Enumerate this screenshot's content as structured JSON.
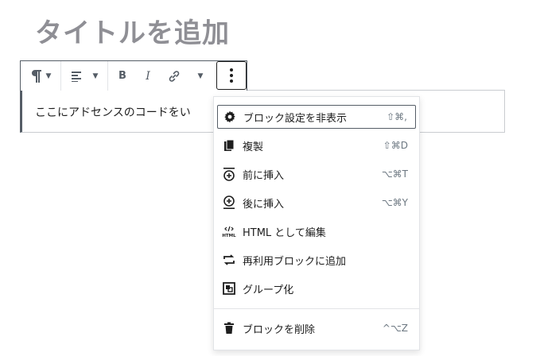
{
  "post": {
    "title_placeholder": "タイトルを追加",
    "block_text": "ここにアドセンスのコードをい"
  },
  "toolbar": {
    "paragraph_icon": "pilcrow-icon",
    "align_icon": "align-left-icon",
    "bold": "B",
    "italic": "I",
    "link_icon": "link-icon",
    "more_icon": "more-vertical-icon"
  },
  "menu": {
    "items": [
      {
        "label": "ブロック設定を非表示",
        "shortcut": "⇧⌘,",
        "icon": "gear-icon"
      },
      {
        "label": "複製",
        "shortcut": "⇧⌘D",
        "icon": "copy-icon"
      },
      {
        "label": "前に挿入",
        "shortcut": "⌥⌘T",
        "icon": "insert-before-icon"
      },
      {
        "label": "後に挿入",
        "shortcut": "⌥⌘Y",
        "icon": "insert-after-icon"
      },
      {
        "label": "HTML として編集",
        "shortcut": "",
        "icon": "html-icon"
      },
      {
        "label": "再利用ブロックに追加",
        "shortcut": "",
        "icon": "reusable-icon"
      },
      {
        "label": "グループ化",
        "shortcut": "",
        "icon": "group-icon"
      },
      {
        "label": "ブロックを削除",
        "shortcut": "^⌥Z",
        "icon": "trash-icon"
      }
    ]
  },
  "colors": {
    "title": "#8f8f95",
    "border_dark": "#555d66",
    "divider": "#e2e4e7"
  }
}
